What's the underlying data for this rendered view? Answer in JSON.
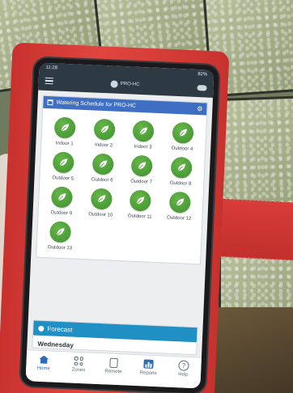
{
  "status_bar": {
    "time": "11:28",
    "battery": "82%"
  },
  "app_bar": {
    "controller_label": "PRO-HC"
  },
  "schedule": {
    "title": "Watering Schedule for PRO-HC",
    "zones": [
      {
        "label": "Indoor 1"
      },
      {
        "label": "Indoor 2"
      },
      {
        "label": "Indoor 3"
      },
      {
        "label": "Outdoor 4"
      },
      {
        "label": "Outdoor 5"
      },
      {
        "label": "Outdoor 6"
      },
      {
        "label": "Outdoor 7"
      },
      {
        "label": "Outdoor 8"
      },
      {
        "label": "Outdoor 9"
      },
      {
        "label": "Outdoor 10"
      },
      {
        "label": "Outdoor 11"
      },
      {
        "label": "Outdoor 12"
      },
      {
        "label": "Outdoor 13"
      }
    ]
  },
  "forecast": {
    "title": "Forecast",
    "day": "Wednesday"
  },
  "bottom_nav": {
    "items": [
      {
        "label": "Home",
        "icon": "home-icon"
      },
      {
        "label": "Zones",
        "icon": "zones-grid-icon"
      },
      {
        "label": "Remote",
        "icon": "remote-icon"
      },
      {
        "label": "Reports",
        "icon": "reports-icon"
      },
      {
        "label": "Help",
        "icon": "help-icon"
      }
    ]
  },
  "colors": {
    "header_blue": "#3f6fc2",
    "zone_green": "#4e9f37",
    "forecast_blue": "#1f8fc4",
    "case_red": "#d83c39"
  }
}
